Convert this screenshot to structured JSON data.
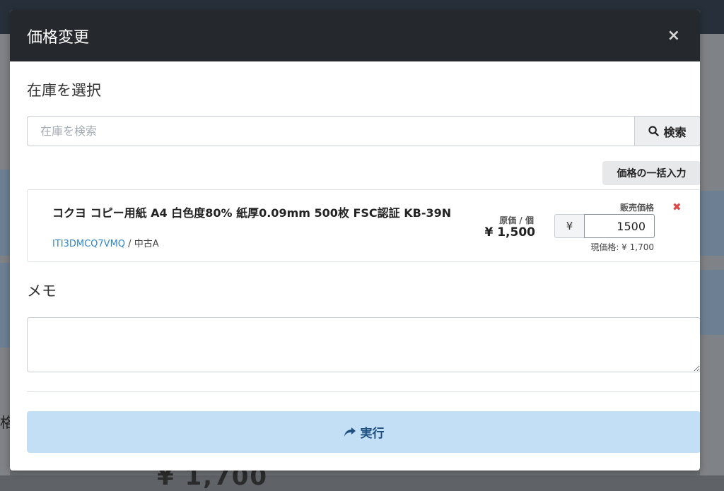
{
  "modal": {
    "title": "価格変更",
    "close_symbol": "×"
  },
  "stock_section": {
    "title": "在庫を選択",
    "search_placeholder": "在庫を検索",
    "search_value": "",
    "search_button_label": "検索",
    "bulk_price_button_label": "価格の一括入力"
  },
  "item": {
    "name": "コクヨ コピー用紙 A4 白色度80% 紙厚0.09mm 500枚 FSC認証 KB-39N",
    "code": "ITI3DMCQ7VMQ",
    "separator": " / ",
    "condition": "中古A",
    "cost_label": "原価 / 個",
    "cost_value": "¥ 1,500",
    "sale_price_label": "販売価格",
    "currency_symbol": "¥",
    "sale_price_value": "1500",
    "current_price_text": "現価格: ¥ 1,700"
  },
  "memo_section": {
    "title": "メモ",
    "value": ""
  },
  "execute_button_label": "実行",
  "background": {
    "partial_price": "¥ 1,700",
    "partial_text": "格"
  },
  "icons": {
    "search": "search-icon",
    "share": "share-icon",
    "remove": "close-x-icon"
  },
  "colors": {
    "header_bg": "#25282c",
    "execute_bg": "#c3dff5",
    "execute_text": "#1d4f80",
    "link": "#2f85c8",
    "remove": "#e04848"
  }
}
